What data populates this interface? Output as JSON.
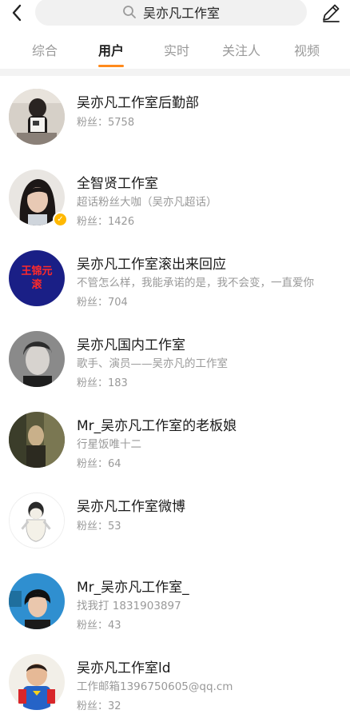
{
  "search": {
    "query": "吴亦凡工作室"
  },
  "tabs": [
    {
      "label": "综合"
    },
    {
      "label": "用户"
    },
    {
      "label": "实时"
    },
    {
      "label": "关注人"
    },
    {
      "label": "视频"
    }
  ],
  "active_tab": "用户",
  "users": [
    {
      "name": "吴亦凡工作室后勤部",
      "desc": "",
      "fans": "粉丝：5758"
    },
    {
      "name": "全智贤工作室",
      "desc": "超话粉丝大咖（吴亦凡超话）",
      "fans": "粉丝：1426",
      "verified": true
    },
    {
      "name": "吴亦凡工作室滚出来回应",
      "desc": "不管怎么样，我能承诺的是，我不会变，一直爱你",
      "fans": "粉丝：704",
      "avatar_text": "王锦元\n滚"
    },
    {
      "name": "吴亦凡国内工作室",
      "desc": "歌手、演员——吴亦凡的工作室",
      "fans": "粉丝：183"
    },
    {
      "name": "Mr_吴亦凡工作室的老板娘",
      "desc": "行星饭唯十二",
      "fans": "粉丝：64"
    },
    {
      "name": "吴亦凡工作室微博",
      "desc": "",
      "fans": "粉丝：53"
    },
    {
      "name": "Mr_吴亦凡工作室_",
      "desc": "找我打 1831903897",
      "fans": "粉丝：43"
    },
    {
      "name": "吴亦凡工作室ld",
      "desc": "工作邮箱1396750605@qq.cm",
      "fans": "粉丝：32"
    }
  ],
  "colors": {
    "accent": "#ff8a1c",
    "verified": "#ffb800",
    "secondary_text": "#999999"
  }
}
